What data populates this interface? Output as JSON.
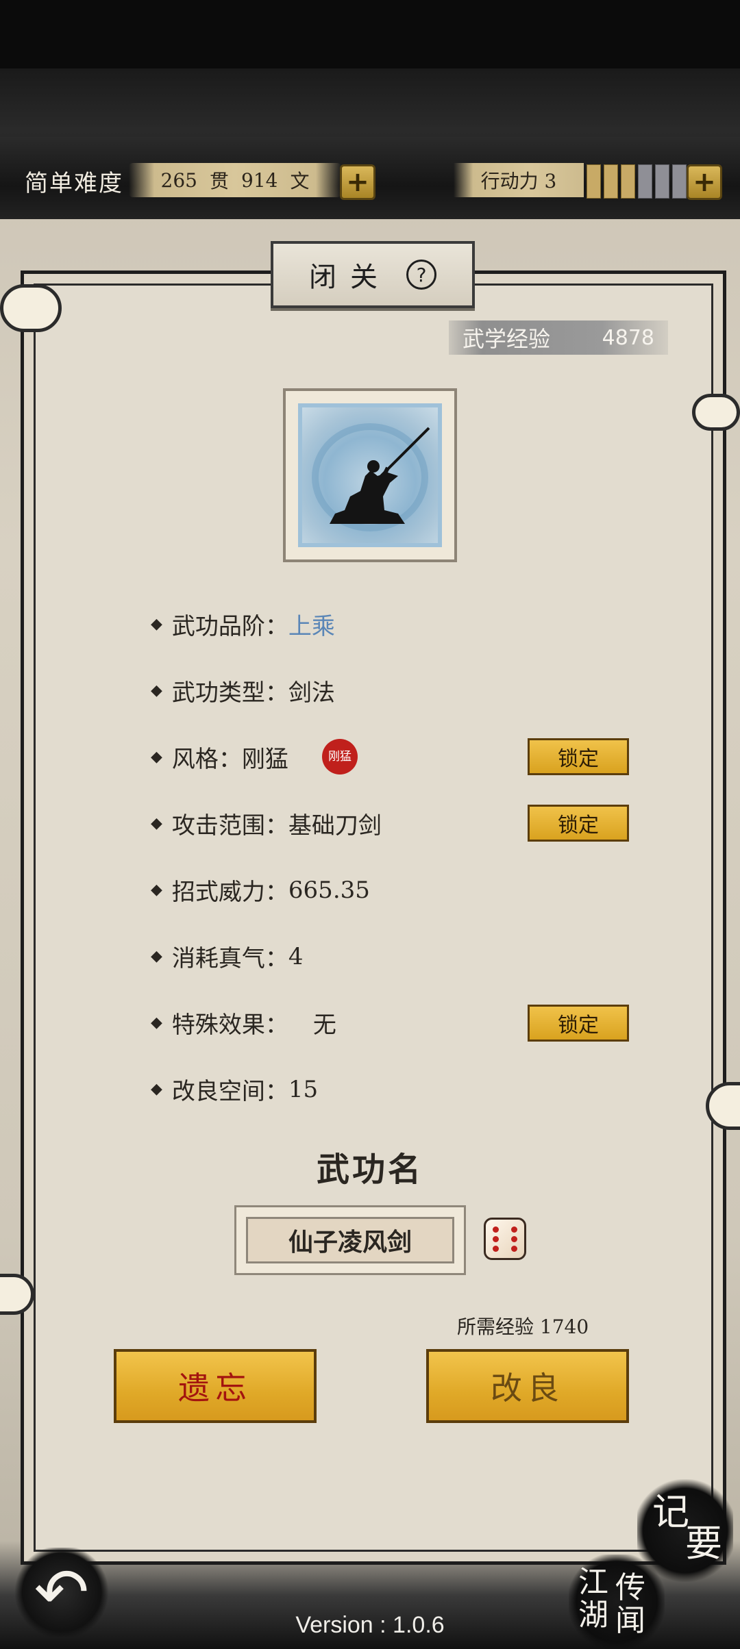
{
  "header": {
    "difficulty": "简单难度",
    "money": {
      "guan": "265",
      "guan_unit": "贯",
      "wen": "914",
      "wen_unit": "文"
    },
    "action_label": "行动力 3",
    "stamina": {
      "filled": 3,
      "total": 7
    }
  },
  "panel": {
    "title": "闭关",
    "exp_label": "武学经验",
    "exp_value": "4878",
    "attributes": {
      "grade_label": "武功品阶：",
      "grade_value": "上乘",
      "type_label": "武功类型：",
      "type_value": "剑法",
      "style_label": "风格：",
      "style_value": "刚猛",
      "style_seal": "刚猛",
      "range_label": "攻击范围：",
      "range_value": "基础刀剑",
      "power_label": "招式威力：",
      "power_value": "665.35",
      "qi_label": "消耗真气：",
      "qi_value": "4",
      "effect_label": "特殊效果：",
      "effect_value": "无",
      "space_label": "改良空间：",
      "space_value": "15"
    },
    "lock_label": "锁定",
    "skill_name_title": "武功名",
    "skill_name": "仙子凌风剑",
    "required_exp": "所需经验 1740",
    "forget_label": "遗忘",
    "improve_label": "改良"
  },
  "nav": {
    "back": "↶",
    "notes": [
      "记",
      "要"
    ],
    "rumors": [
      "江",
      "湖",
      "传",
      "闻"
    ]
  },
  "footer": {
    "version": "Version : 1.0.6"
  },
  "colors": {
    "accent_gold": "#e0a928",
    "grade_blue": "#5a86b7",
    "seal_red": "#c0201c"
  }
}
